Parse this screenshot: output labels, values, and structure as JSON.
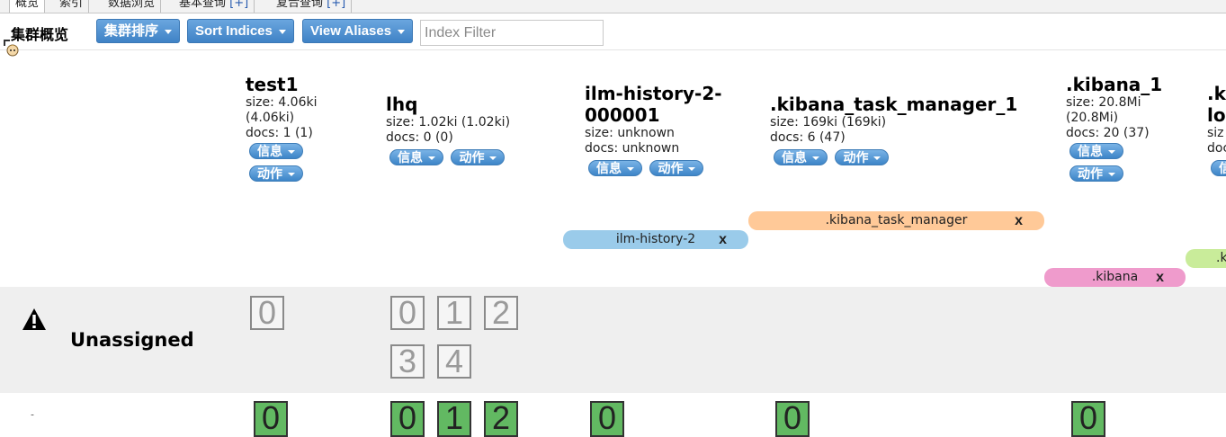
{
  "tabs": [
    {
      "label": "概览",
      "plus": ""
    },
    {
      "label": "索引",
      "plus": ""
    },
    {
      "label": "数据浏览",
      "plus": ""
    },
    {
      "label": "基本查询",
      "plus": "[+]"
    },
    {
      "label": "复合查询",
      "plus": "[+]"
    }
  ],
  "toolbar": {
    "cluster_title": "集群概览",
    "cluster_sort": "集群排序",
    "sort_indices": "Sort Indices",
    "view_aliases": "View Aliases",
    "filter_placeholder": "Index Filter"
  },
  "indices": [
    {
      "name": "test1",
      "size": "size: 4.06ki",
      "size2": "(4.06ki)",
      "docs": "docs: 1 (1)",
      "info": "信息",
      "action": "动作"
    },
    {
      "name": "lhq",
      "size": "size: 1.02ki (1.02ki)",
      "docs": "docs: 0 (0)",
      "info": "信息",
      "action": "动作"
    },
    {
      "name": "ilm-history-2-",
      "name2": "000001",
      "size": "size: unknown",
      "docs": "docs: unknown",
      "info": "信息",
      "action": "动作"
    },
    {
      "name": ".kibana_task_manager_1",
      "size": "size: 169ki (169ki)",
      "docs": "docs: 6 (47)",
      "info": "信息",
      "action": "动作"
    },
    {
      "name": ".kibana_1",
      "size": "size: 20.8Mi",
      "size2": "(20.8Mi)",
      "docs": "docs: 20 (37)",
      "info": "信息",
      "action": "动作"
    },
    {
      "name": ".k",
      "name2": "lo",
      "size": "siz",
      "docs": "doc",
      "info": "信息"
    }
  ],
  "aliases": [
    {
      "label": ".kibana_task_manager",
      "remove": "x",
      "color": "#ffc998"
    },
    {
      "label": "ilm-history-2",
      "remove": "x",
      "color": "#9acbea"
    },
    {
      "label": ".kibana",
      "remove": "x",
      "color": "#ef9bcc"
    },
    {
      "label": ".k",
      "remove": "",
      "color": "#c9ec9a"
    }
  ],
  "unassigned": {
    "label": "Unassigned",
    "test1_shards": [
      "0"
    ],
    "lhq_shards": [
      "0",
      "1",
      "2",
      "3",
      "4"
    ]
  },
  "node_row": {
    "test1_shards": [
      "0"
    ],
    "lhq_shards": [
      "0",
      "1",
      "2"
    ],
    "ilm_shards": [
      "0"
    ],
    "kibana_task_shards": [
      "0"
    ],
    "kibana_shards": [
      "0"
    ]
  },
  "colors": {
    "button_blue": "#3f82c6",
    "shard_green": "#62b962",
    "band_gray": "#efefef"
  }
}
